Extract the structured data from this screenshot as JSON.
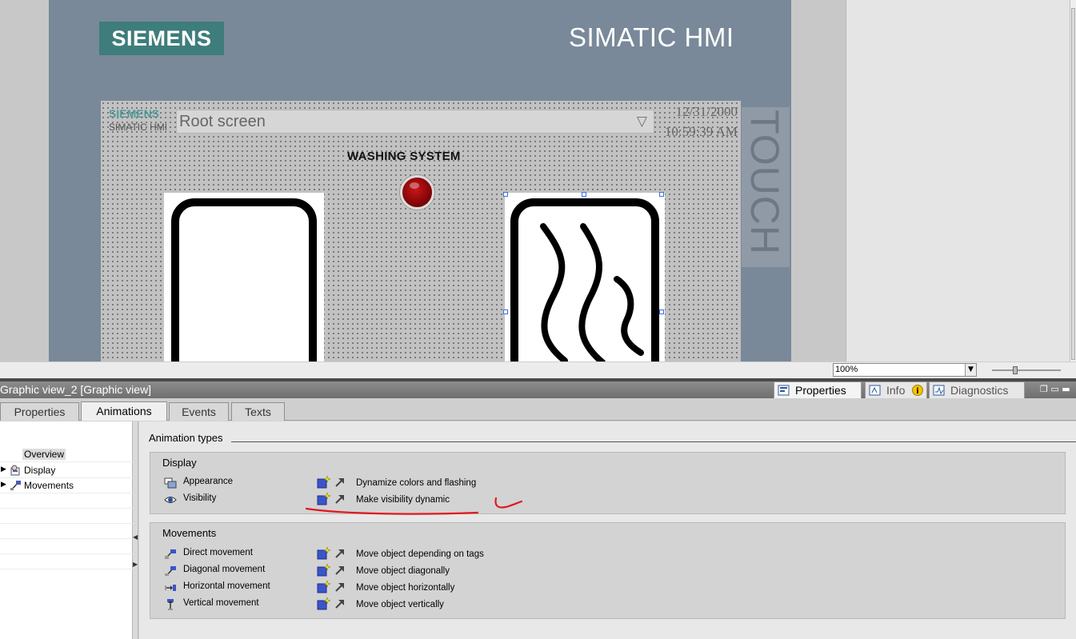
{
  "device": {
    "brand_logo": "SIEMENS",
    "brand_title": "SIMATIC HMI",
    "touch_label": "TOUCH"
  },
  "hmi_screen": {
    "mini_brand": "SIEMENS",
    "mini_subbrand": "SIMATIC HMI",
    "screen_selector": "Root screen",
    "date": "12/31/2000",
    "time": "10:59:39 AM",
    "title": "WASHING SYSTEM"
  },
  "zoom": {
    "value": "100%"
  },
  "inspector": {
    "title": "Graphic view_2 [Graphic view]",
    "tabs": [
      {
        "label": "Properties",
        "icon": "properties-icon"
      },
      {
        "label": "Info",
        "icon": "info-icon"
      },
      {
        "label": "Diagnostics",
        "icon": "diagnostics-icon"
      }
    ],
    "sub_tabs": [
      "Properties",
      "Animations",
      "Events",
      "Texts"
    ],
    "active_sub_tab": "Animations"
  },
  "tree": {
    "items": [
      {
        "label": "Overview",
        "selected": true
      },
      {
        "label": "Display",
        "icon": "display-icon",
        "expandable": true
      },
      {
        "label": "Movements",
        "icon": "movements-icon",
        "expandable": true
      }
    ]
  },
  "animations": {
    "section_label": "Animation types",
    "groups": [
      {
        "title": "Display",
        "rows": [
          {
            "type": "Appearance",
            "icon": "appearance-icon",
            "description": "Dynamize colors and flashing"
          },
          {
            "type": "Visibility",
            "icon": "visibility-eye-icon",
            "description": "Make visibility dynamic"
          }
        ]
      },
      {
        "title": "Movements",
        "rows": [
          {
            "type": "Direct movement",
            "icon": "direct-movement-icon",
            "description": "Move object depending on tags"
          },
          {
            "type": "Diagonal movement",
            "icon": "diagonal-movement-icon",
            "description": "Move object diagonally"
          },
          {
            "type": "Horizontal movement",
            "icon": "horizontal-movement-icon",
            "description": "Move object horizontally"
          },
          {
            "type": "Vertical movement",
            "icon": "vertical-movement-icon",
            "description": "Move object vertically"
          }
        ]
      }
    ]
  },
  "colors": {
    "device_frame": "#798999",
    "siemens_teal": "#3e7d7b",
    "lamp_red": "#a30a0d",
    "annotation_red": "#e0191f"
  }
}
